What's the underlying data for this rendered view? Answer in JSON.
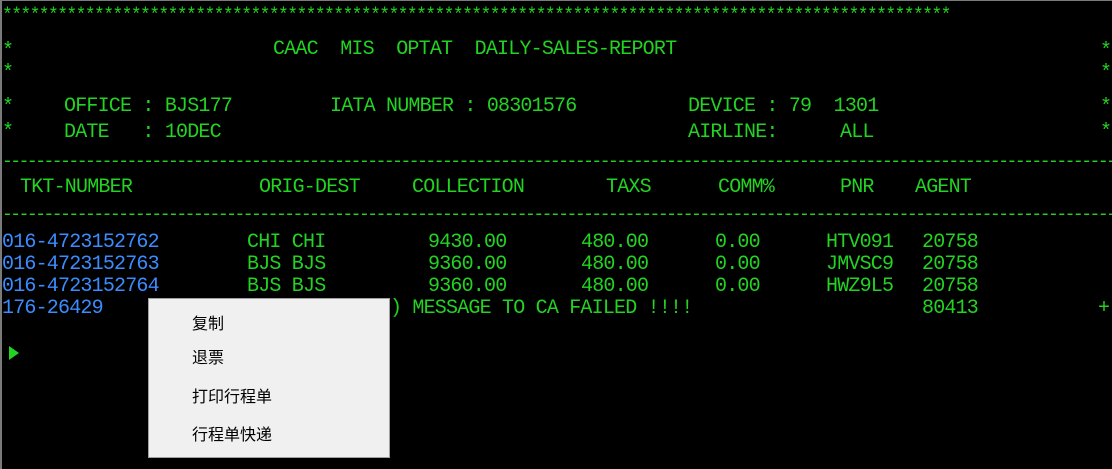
{
  "terminal": {
    "border_stars": "*******************************************************************************************************",
    "star": "*",
    "title": "CAAC  MIS  OPTAT  DAILY-SALES-REPORT",
    "office_label": "OFFICE : BJS177",
    "iata_label": "IATA NUMBER : 08301576",
    "device_label": "DEVICE : 79  1301",
    "date_label": "DATE   : 10DEC",
    "airline_label": "AIRLINE:",
    "airline_value": "ALL",
    "dash_line": "--------------------------------------------------------------------------------------------------------------------------------------------------------------",
    "headers": [
      "TKT-NUMBER",
      "ORIG-DEST",
      "COLLECTION",
      "TAXS",
      "COMM%",
      "PNR",
      "AGENT"
    ],
    "rows": [
      {
        "ticket": "016-4723152762",
        "orig_dest": "CHI CHI",
        "collection": "9430.00",
        "taxs": "480.00",
        "comm": "0.00",
        "pnr": "HTV091",
        "agent": "20758"
      },
      {
        "ticket": "016-4723152763",
        "orig_dest": "BJS BJS",
        "collection": "9360.00",
        "taxs": "480.00",
        "comm": "0.00",
        "pnr": "JMVSC9",
        "agent": "20758"
      },
      {
        "ticket": "016-4723152764",
        "orig_dest": "BJS BJS",
        "collection": "9360.00",
        "taxs": "480.00",
        "comm": "0.00",
        "pnr": "HWZ9L5",
        "agent": "20758"
      }
    ],
    "error_row": {
      "ticket": "176-26429",
      "message": ") MESSAGE TO CA FAILED !!!!",
      "agent": "80413",
      "plus": "+"
    }
  },
  "context_menu": {
    "items": [
      "复制",
      "退票",
      "打印行程单",
      "行程单快递"
    ]
  },
  "colors": {
    "background": "#000000",
    "text_green": "#22d322",
    "ticket_blue": "#3a8cff",
    "menu_bg": "#f0f0f0"
  }
}
